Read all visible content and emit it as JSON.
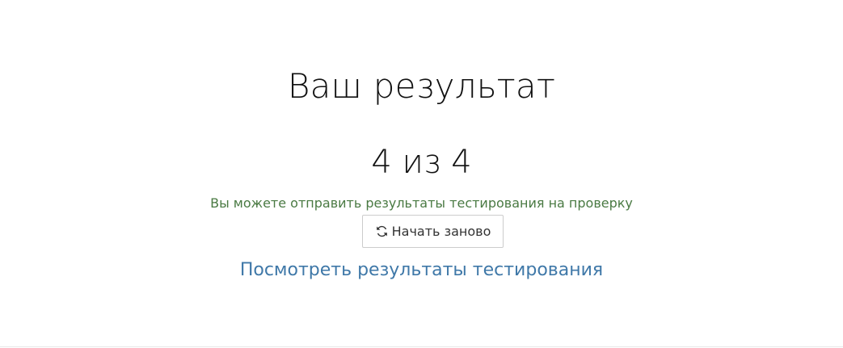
{
  "result": {
    "title": "Ваш результат",
    "score": "4 из 4",
    "hint": "Вы можете отправить результаты тестирования на проверку",
    "restart_label": "Начать заново",
    "restart_icon": "refresh-icon",
    "view_results_link": "Посмотреть результаты тестирования"
  },
  "colors": {
    "hint": "#4a7a43",
    "link": "#3f78a8",
    "button_border": "#cccccc"
  }
}
